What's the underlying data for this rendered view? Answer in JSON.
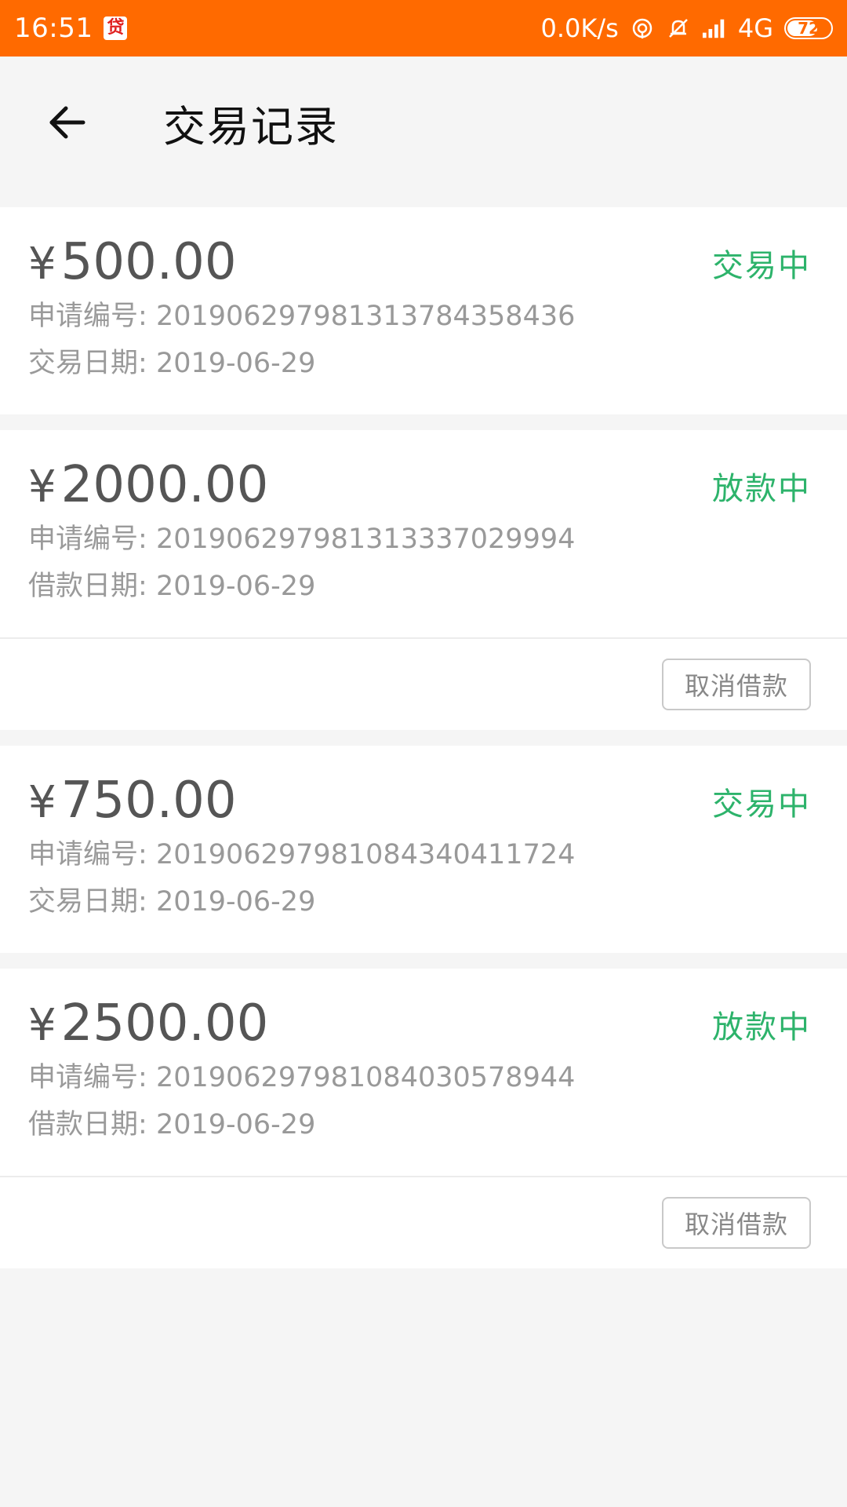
{
  "status_bar": {
    "time": "16:51",
    "app_icon_text": "贷",
    "net_speed": "0.0K/s",
    "network": "4G",
    "battery": "72",
    "icons": [
      "hotspot-icon",
      "mute-icon",
      "signal-icon"
    ]
  },
  "header": {
    "title": "交易记录",
    "back_icon": "arrow-left-icon"
  },
  "colors": {
    "status_bar": "#ff6a00",
    "status_green": "#2db36b",
    "background": "#f5f5f5"
  },
  "records": [
    {
      "currency": "¥",
      "amount": "500.00",
      "status": "交易中",
      "application_label": "申请编号:",
      "application_no": "201906297981313784358436",
      "date_label": "交易日期:",
      "date": "2019-06-29",
      "has_cancel": false
    },
    {
      "currency": "¥",
      "amount": "2000.00",
      "status": "放款中",
      "application_label": "申请编号:",
      "application_no": "201906297981313337029994",
      "date_label": "借款日期:",
      "date": "2019-06-29",
      "has_cancel": true,
      "cancel_label": "取消借款"
    },
    {
      "currency": "¥",
      "amount": "750.00",
      "status": "交易中",
      "application_label": "申请编号:",
      "application_no": "201906297981084340411724",
      "date_label": "交易日期:",
      "date": "2019-06-29",
      "has_cancel": false
    },
    {
      "currency": "¥",
      "amount": "2500.00",
      "status": "放款中",
      "application_label": "申请编号:",
      "application_no": "201906297981084030578944",
      "date_label": "借款日期:",
      "date": "2019-06-29",
      "has_cancel": true,
      "cancel_label": "取消借款"
    }
  ]
}
